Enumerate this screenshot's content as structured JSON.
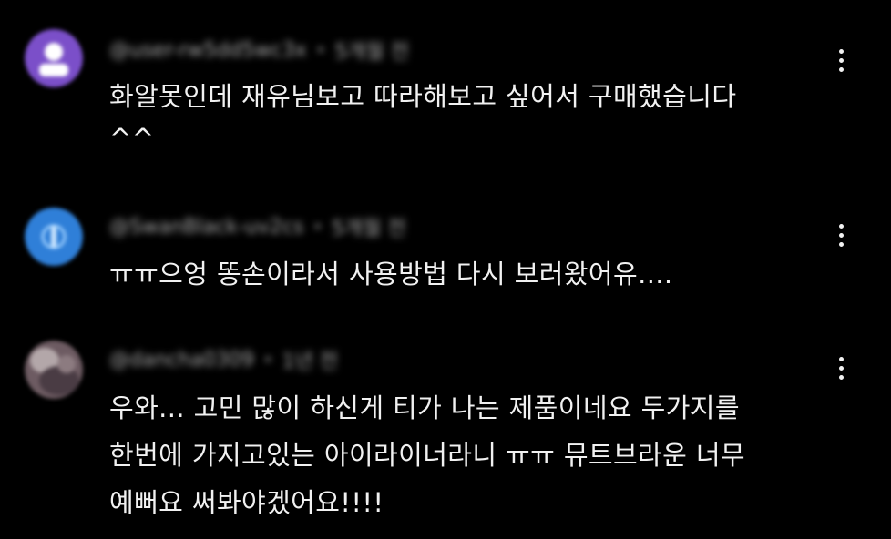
{
  "comments": [
    {
      "author": "@user-rw5dd5wc3x",
      "time": "5개월 전",
      "lines": [
        "화알못인데 재유님보고 따라해보고 싶어서 구매했습니다",
        "^^"
      ],
      "avatar_color": "#7b4fc9",
      "avatar_icon": "person-silhouette-icon"
    },
    {
      "author": "@SwanBlack-uv2cs",
      "time": "5개월 전",
      "lines": [
        "ㅠㅠ으엉 똥손이라서 사용방법 다시 보러왔어유...."
      ],
      "avatar_color": "#2f7fd8",
      "avatar_icon": "letter-s-icon"
    },
    {
      "author": "@dancha0309",
      "time": "1년 전",
      "lines": [
        "우와... 고민 많이 하신게 티가 나는 제품이네요 두가지를",
        "한번에 가지고있는 아이라이너라니 ㅠㅠ 뮤트브라운 너무",
        "예뻐요 써봐야겠어요!!!!"
      ],
      "avatar_color": "#6d5b62",
      "avatar_icon": "profile-photo"
    }
  ],
  "menu_icon": "more-vertical-icon",
  "separator": "•"
}
